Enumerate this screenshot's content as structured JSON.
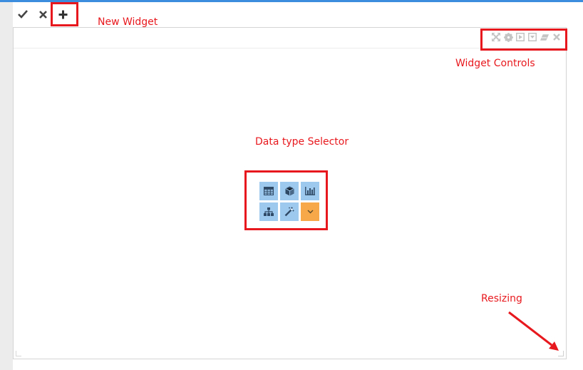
{
  "toolbar": {
    "buttons": [
      {
        "name": "confirm",
        "icon": "check-icon"
      },
      {
        "name": "cancel",
        "icon": "close-icon"
      },
      {
        "name": "add-widget",
        "icon": "plus-icon"
      }
    ]
  },
  "annotations": {
    "new_widget": "New Widget",
    "widget_controls": "Widget Controls",
    "data_type_selector": "Data type Selector",
    "resizing": "Resizing"
  },
  "widget": {
    "controls": [
      "fullscreen-icon",
      "gear-icon",
      "play-icon",
      "dropdown-icon",
      "eraser-icon",
      "close-icon"
    ],
    "data_types": [
      "table-icon",
      "cube-icon",
      "bar-chart-icon",
      "hierarchy-icon",
      "magic-wand-icon",
      "chevron-down-icon"
    ]
  },
  "colors": {
    "accent_line": "#3c8dde",
    "annotation": "#e8191e",
    "data_type_tile": "#9ec9ee",
    "more_tile": "#f7a94a",
    "control_icon": "#c4c4c4"
  }
}
